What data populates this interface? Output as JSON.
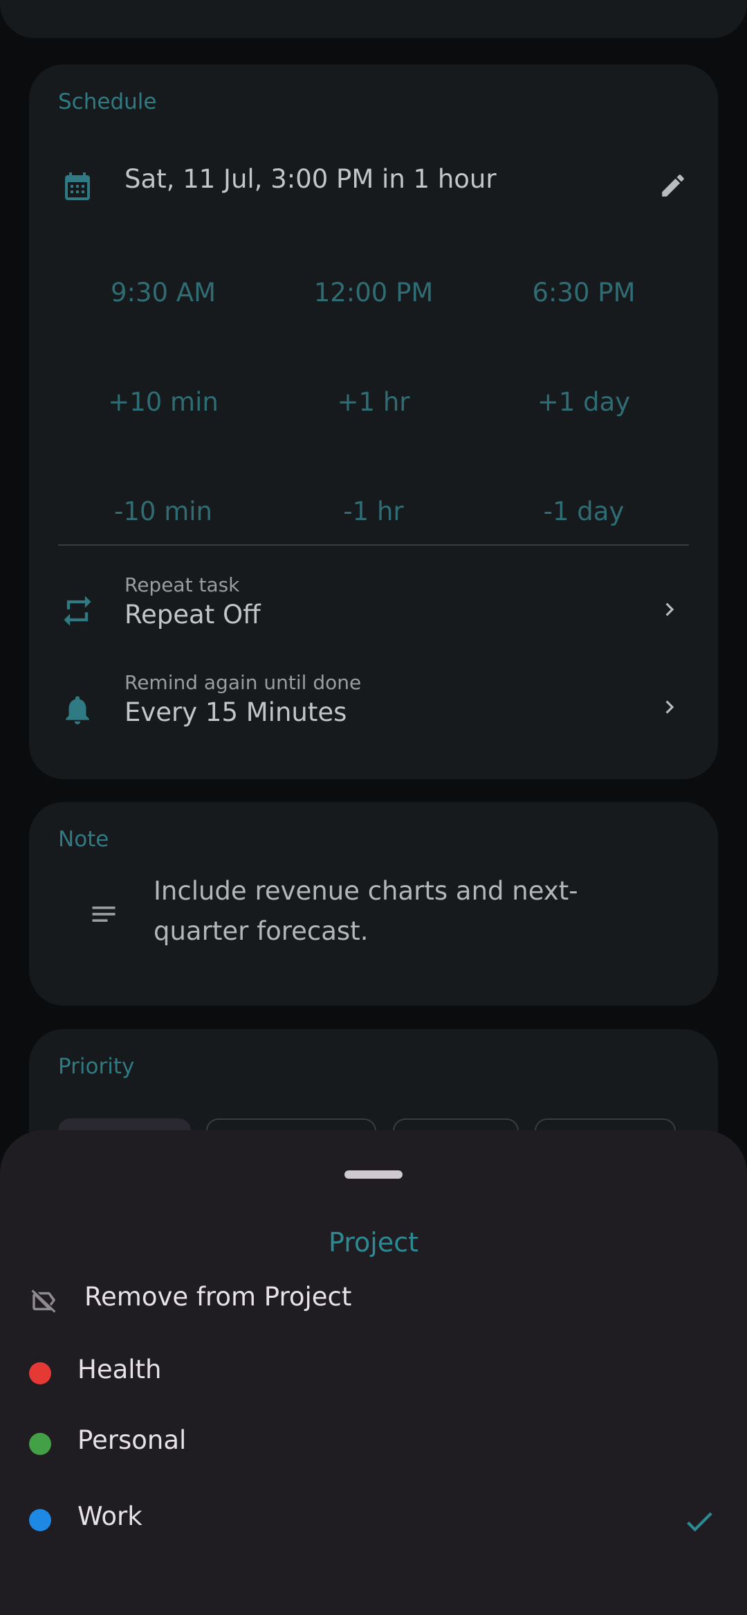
{
  "schedule": {
    "title": "Schedule",
    "date_text": "Sat, 11 Jul, 3:00 PM in 1 hour",
    "quick_times": [
      "9:30 AM",
      "12:00 PM",
      "6:30 PM"
    ],
    "plus_adjust": [
      "+10 min",
      "+1 hr",
      "+1 day"
    ],
    "minus_adjust": [
      "-10 min",
      "-1 hr",
      "-1 day"
    ],
    "repeat": {
      "label": "Repeat task",
      "value": "Repeat Off"
    },
    "remind": {
      "label": "Remind again until done",
      "value": "Every 15 Minutes"
    }
  },
  "note": {
    "title": "Note",
    "text": "Include revenue charts and next-quarter forecast."
  },
  "priority": {
    "title": "Priority"
  },
  "project_sheet": {
    "title": "Project",
    "remove_label": "Remove from Project",
    "projects": [
      {
        "name": "Health",
        "color": "#e53935",
        "selected": false
      },
      {
        "name": "Personal",
        "color": "#43a047",
        "selected": false
      },
      {
        "name": "Work",
        "color": "#1e88e5",
        "selected": true
      }
    ]
  },
  "colors": {
    "accent": "#2f7a83",
    "background": "#0b0c0d",
    "card": "#171a1c",
    "sheet": "#1f1c22"
  }
}
